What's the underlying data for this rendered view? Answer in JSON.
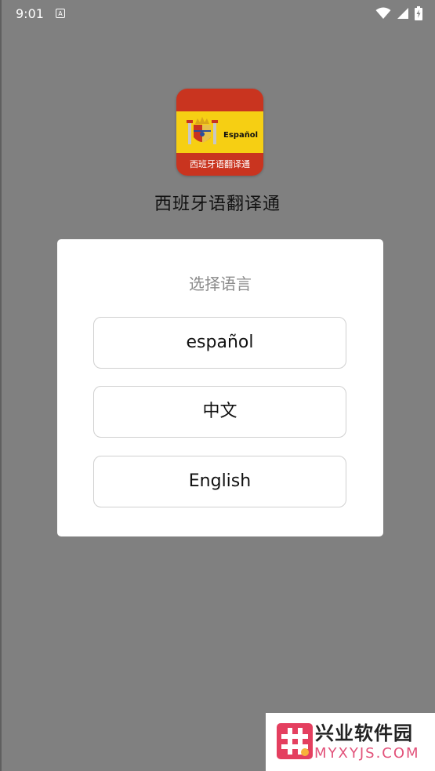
{
  "status_bar": {
    "time": "9:01",
    "notification_glyph": "A",
    "icons": [
      "wifi-icon",
      "signal-icon",
      "battery-charging-icon"
    ]
  },
  "app": {
    "icon_name": "spain-flag-app-icon",
    "icon_label_top": "Español",
    "icon_label_bottom": "西班牙语翻译通",
    "title": "西班牙语翻译通"
  },
  "dialog": {
    "title": "选择语言",
    "options": [
      {
        "label": "español"
      },
      {
        "label": "中文"
      },
      {
        "label": "English"
      }
    ]
  },
  "watermark": {
    "name": "兴业软件园",
    "domain": "MYXYJS.COM"
  },
  "colors": {
    "scrim": "#808080",
    "dialog_bg": "#ffffff",
    "button_border": "#d0d0d0",
    "flag_red": "#c9341f",
    "flag_yellow": "#f6cf13",
    "watermark_pink": "#e43f5f"
  }
}
